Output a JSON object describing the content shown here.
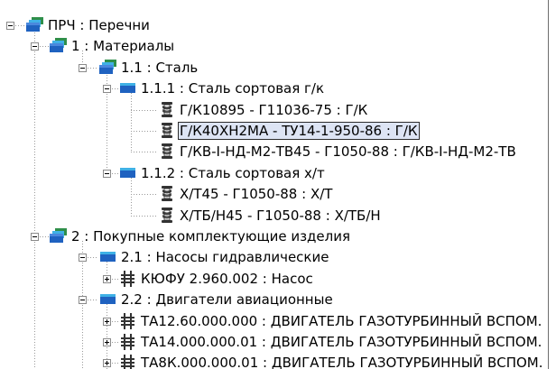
{
  "tree": {
    "nodes": [
      {
        "name": "tree-node-prch",
        "label": "ПРЧ : Перечни",
        "icon": "stacked-folders-icon",
        "level": 0,
        "expander": "minus",
        "selected": false
      },
      {
        "name": "tree-node-materials",
        "label": "1 : Материалы",
        "icon": "stacked-folders-icon",
        "level": 1,
        "expander": "minus",
        "selected": false
      },
      {
        "name": "tree-node-steel",
        "label": "1.1 : Сталь",
        "icon": "stacked-folders-icon",
        "level": 2,
        "expander": "minus",
        "selected": false
      },
      {
        "name": "tree-node-steel-hot",
        "label": "1.1.1 : Сталь сортовая г/к",
        "icon": "folder-icon",
        "level": 3,
        "expander": "minus",
        "selected": false
      },
      {
        "name": "tree-leaf-steel-hot-1",
        "label": "Г/К10895 - Г11036-75 : Г/К",
        "icon": "coil-icon",
        "level": 4,
        "expander": "none",
        "selected": false
      },
      {
        "name": "tree-leaf-steel-hot-2",
        "label": "Г/К40ХН2МА - ТУ14-1-950-86 : Г/К",
        "icon": "coil-icon",
        "level": 4,
        "expander": "none",
        "selected": true
      },
      {
        "name": "tree-leaf-steel-hot-3",
        "label": "Г/КВ-I-НД-М2-ТВ45 - Г1050-88 : Г/КВ-I-НД-М2-ТВ",
        "icon": "coil-icon",
        "level": 4,
        "expander": "none",
        "selected": false
      },
      {
        "name": "tree-node-steel-cold",
        "label": "1.1.2 : Сталь сортовая х/т",
        "icon": "folder-icon",
        "level": 3,
        "expander": "minus",
        "selected": false
      },
      {
        "name": "tree-leaf-steel-cold-1",
        "label": "Х/Т45 - Г1050-88 : Х/Т",
        "icon": "coil-icon",
        "level": 4,
        "expander": "none",
        "selected": false
      },
      {
        "name": "tree-leaf-steel-cold-2",
        "label": "Х/ТБ/Н45 - Г1050-88 : Х/ТБ/Н",
        "icon": "coil-icon",
        "level": 4,
        "expander": "none",
        "selected": false
      },
      {
        "name": "tree-node-purchased",
        "label": "2 : Покупные комплектующие изделия",
        "icon": "stacked-folders-icon",
        "level": 1,
        "expander": "minus",
        "selected": false
      },
      {
        "name": "tree-node-pumps",
        "label": "2.1 : Насосы гидравлические",
        "icon": "folder-icon",
        "level": 2,
        "expander": "minus",
        "selected": false
      },
      {
        "name": "tree-node-pump-1",
        "label": "КЮФУ 2.960.002 : Насос",
        "icon": "assembly-icon",
        "level": 3,
        "expander": "plus",
        "selected": false
      },
      {
        "name": "tree-node-engines",
        "label": "2.2 : Двигатели авиационные",
        "icon": "folder-icon",
        "level": 2,
        "expander": "minus",
        "selected": false
      },
      {
        "name": "tree-node-engine-1",
        "label": "ТА12.60.000.000 : ДВИГАТЕЛЬ ГАЗОТУРБИННЫЙ ВСПОМ.",
        "icon": "assembly-icon",
        "level": 3,
        "expander": "plus",
        "selected": false
      },
      {
        "name": "tree-node-engine-2",
        "label": "ТА14.000.000.01 : ДВИГАТЕЛЬ ГАЗОТУРБИННЫЙ ВСПОМ.",
        "icon": "assembly-icon",
        "level": 3,
        "expander": "plus",
        "selected": false
      },
      {
        "name": "tree-node-engine-3",
        "label": "ТА8К.000.000.01 : ДВИГАТЕЛЬ ГАЗОТУРБИННЫЙ ВСПОМ.",
        "icon": "assembly-icon",
        "level": 3,
        "expander": "plus",
        "selected": false
      }
    ]
  },
  "colors": {
    "folder_blue": "#1f62c0",
    "folder_cyan": "#3fb1e6",
    "folder_green": "#2f8f4a",
    "selection_fill": "#dde4f4",
    "tree_lines": "#9a9a9a"
  }
}
